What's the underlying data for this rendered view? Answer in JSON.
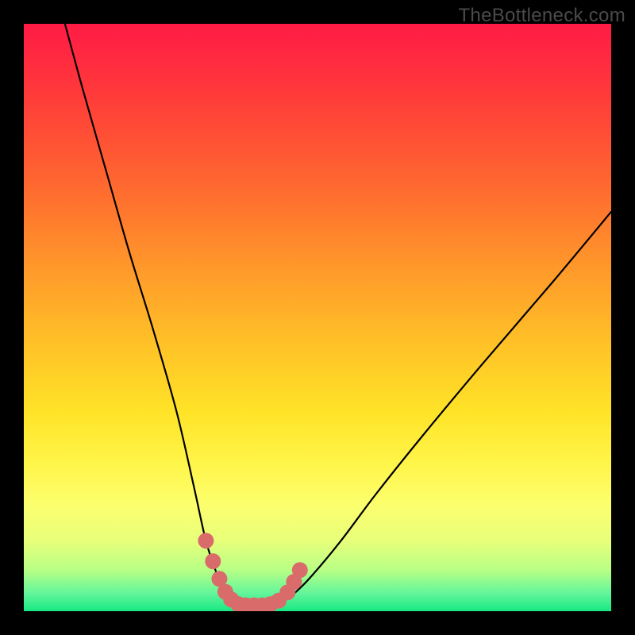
{
  "watermark": "TheBottleneck.com",
  "chart_data": {
    "type": "line",
    "title": "",
    "xlabel": "",
    "ylabel": "",
    "xlim": [
      0,
      100
    ],
    "ylim": [
      0,
      100
    ],
    "series": [
      {
        "name": "bottleneck-curve",
        "x": [
          7,
          10,
          14,
          18,
          22,
          26,
          29,
          31,
          33,
          34.5,
          36,
          38,
          40,
          42,
          44,
          46,
          49,
          54,
          60,
          68,
          78,
          90,
          100
        ],
        "y": [
          100,
          89,
          75,
          61,
          48,
          34,
          21,
          12,
          6,
          3,
          1.5,
          1,
          1,
          1.2,
          1.8,
          3,
          6,
          12,
          20,
          30,
          42,
          56,
          68
        ]
      }
    ],
    "markers": {
      "name": "highlight-dots",
      "color": "#da6b6b",
      "points_x": [
        31.0,
        32.2,
        33.3,
        34.3,
        35.3,
        36.5,
        37.8,
        39.2,
        40.6,
        42.0,
        43.4,
        44.9,
        46.0,
        47.0
      ],
      "points_y": [
        12.0,
        8.5,
        5.5,
        3.3,
        2.0,
        1.2,
        1.0,
        1.0,
        1.0,
        1.2,
        1.8,
        3.2,
        5.0,
        7.0
      ]
    }
  }
}
